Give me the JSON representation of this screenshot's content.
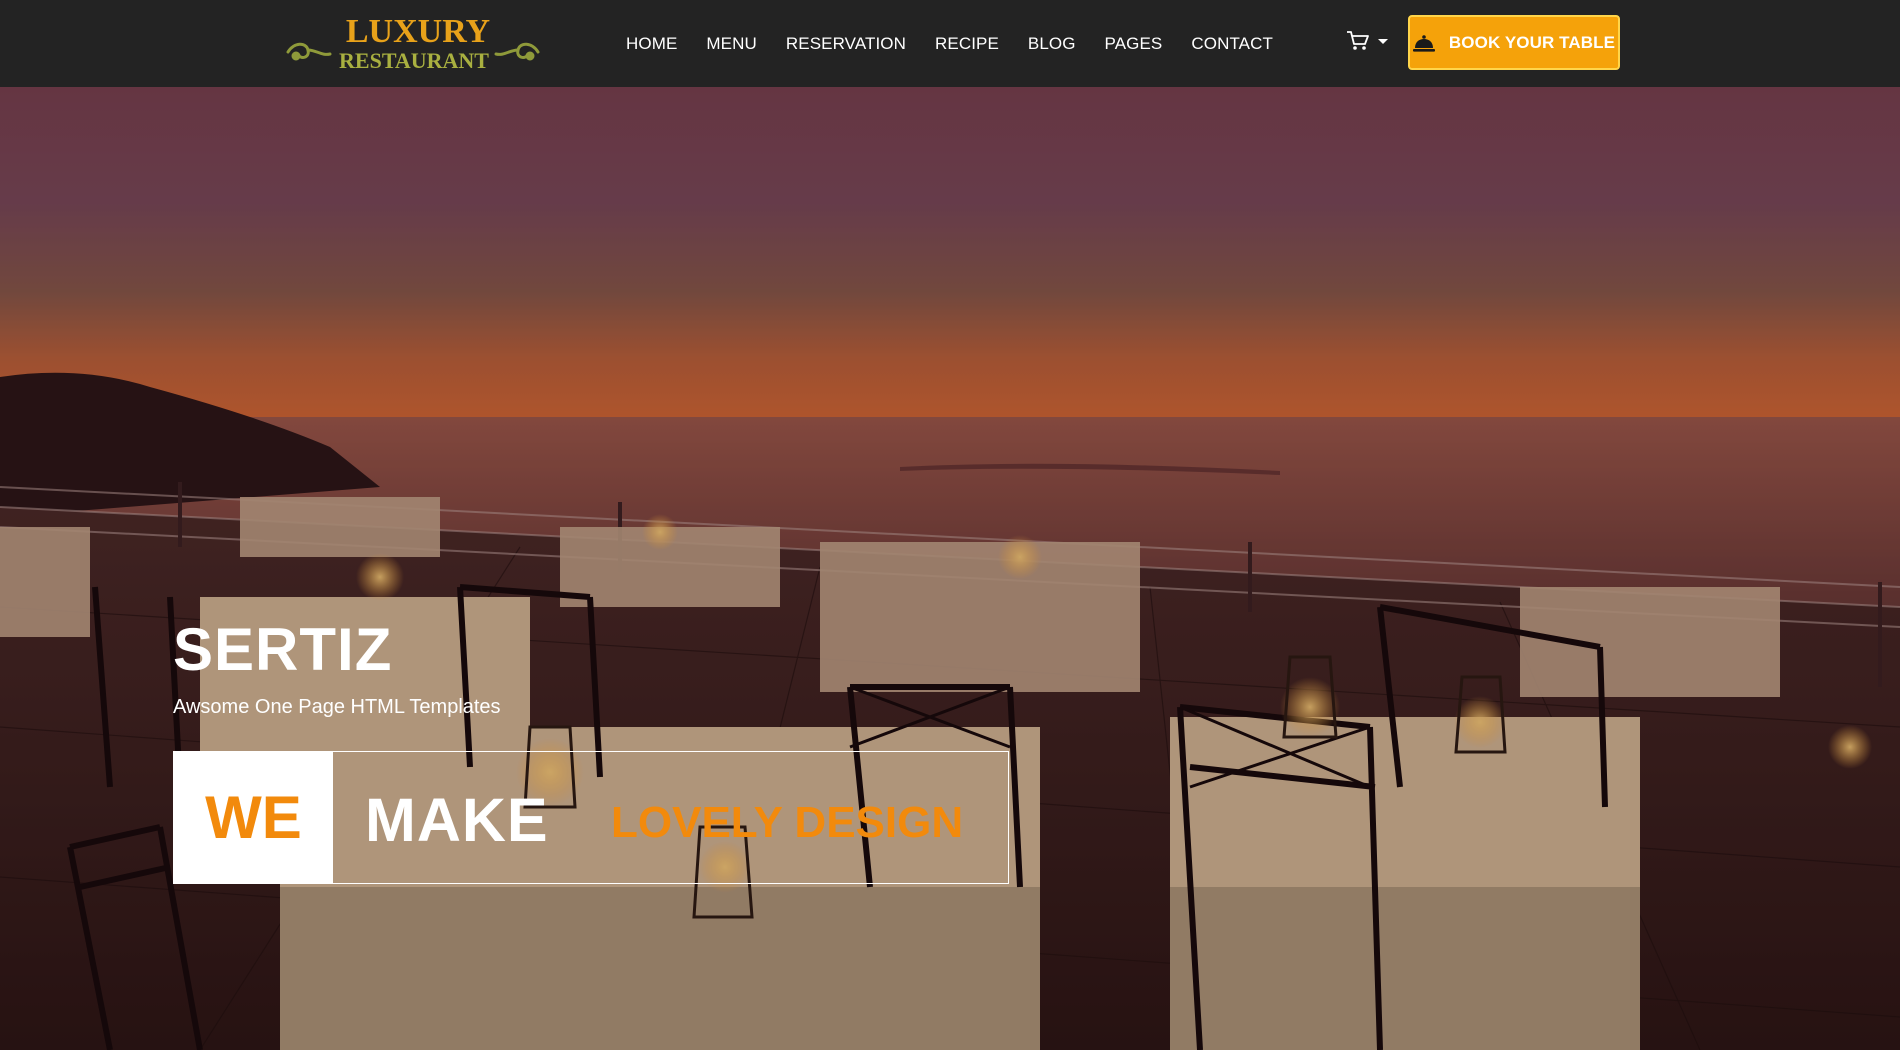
{
  "brand": {
    "line1": "LUXURY",
    "line2": "RESTAURANT",
    "color": "#e8a21a",
    "ornament_color": "#8f9a3a"
  },
  "nav": {
    "items": [
      {
        "label": "HOME"
      },
      {
        "label": "MENU"
      },
      {
        "label": "RESERVATION"
      },
      {
        "label": "RECIPE"
      },
      {
        "label": "BLOG"
      },
      {
        "label": "PAGES"
      },
      {
        "label": "CONTACT"
      }
    ],
    "cart_icon": "cart-icon",
    "cart_caret_icon": "caret-down-icon",
    "book_button": {
      "label": "BOOK YOUR TABLE",
      "icon": "service-bell-icon",
      "color": "#f5a20a"
    }
  },
  "hero": {
    "title": "SERTIZ",
    "subtitle": "Awsome One Page HTML Templates",
    "tagline": {
      "we": "WE",
      "make": "MAKE",
      "design": "LOVELY DESIGN",
      "accent_color": "#f28a0c"
    },
    "background": "sunset-seaside-restaurant-terrace-photo"
  }
}
